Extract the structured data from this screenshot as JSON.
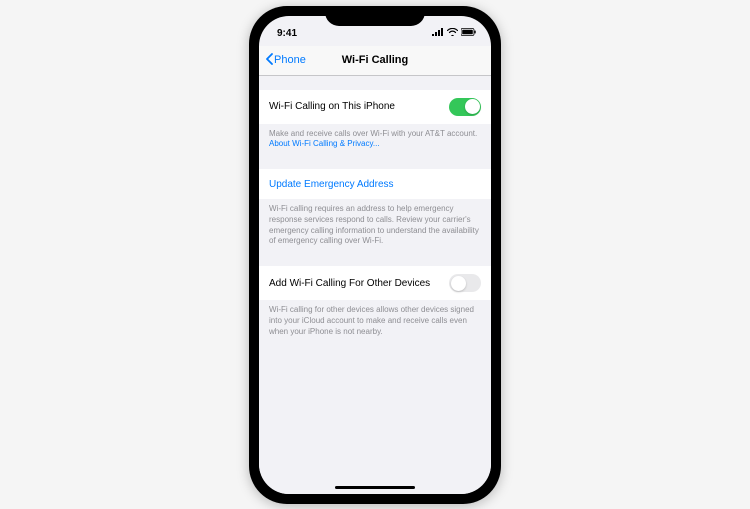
{
  "statusbar": {
    "time": "9:41"
  },
  "nav": {
    "back_label": "Phone",
    "title": "Wi-Fi Calling"
  },
  "section1": {
    "row_label": "Wi-Fi Calling on This iPhone",
    "toggle_on": true,
    "footer_text": "Make and receive calls over Wi-Fi with your AT&T account.",
    "footer_link": "About Wi-Fi Calling & Privacy..."
  },
  "section2": {
    "row_label": "Update Emergency Address",
    "footer_text": "Wi-Fi calling requires an address to help emergency response services respond to calls. Review your carrier's emergency calling information to understand the availability of emergency calling over Wi-Fi."
  },
  "section3": {
    "row_label": "Add Wi-Fi Calling For Other Devices",
    "toggle_on": false,
    "footer_text": "Wi-Fi calling for other devices allows other devices signed into your iCloud account to make and receive calls even when your iPhone is not nearby."
  }
}
